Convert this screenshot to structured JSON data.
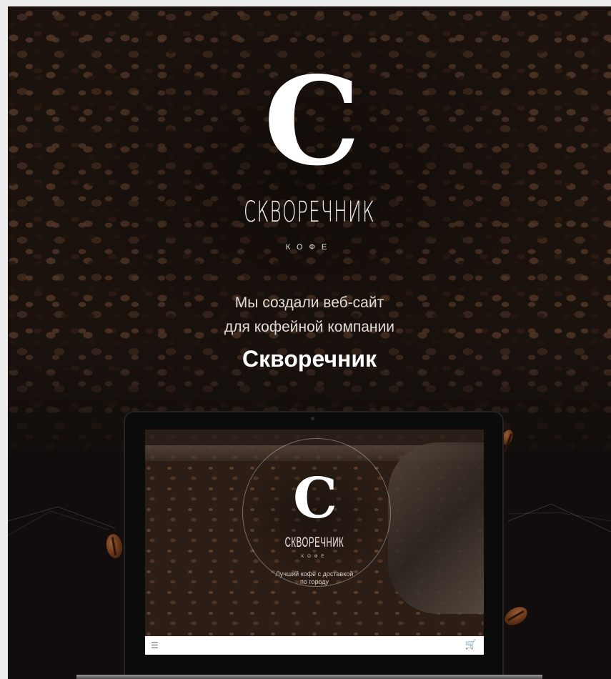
{
  "hero": {
    "logo_letter": "C",
    "brand_name": "СКВОРЕЧНИК",
    "brand_sub": "КОФЕ",
    "tagline_line1": "Мы создали веб-сайт",
    "tagline_line2": "для кофейной компании",
    "tagline_name": "Скворечник"
  },
  "screen": {
    "logo_letter": "C",
    "brand_name": "СКВОРЕЧНИК",
    "brand_sub": "КОФЕ",
    "tagline_line1": "Лучший кофе с доставкой",
    "tagline_line2": "по городу"
  },
  "navbar": {
    "menu_icon": "☰",
    "cart_icon": "🛒"
  },
  "colors": {
    "background": "#110d0c",
    "accent": "#ffffff",
    "screen_nav": "#ffffff"
  }
}
